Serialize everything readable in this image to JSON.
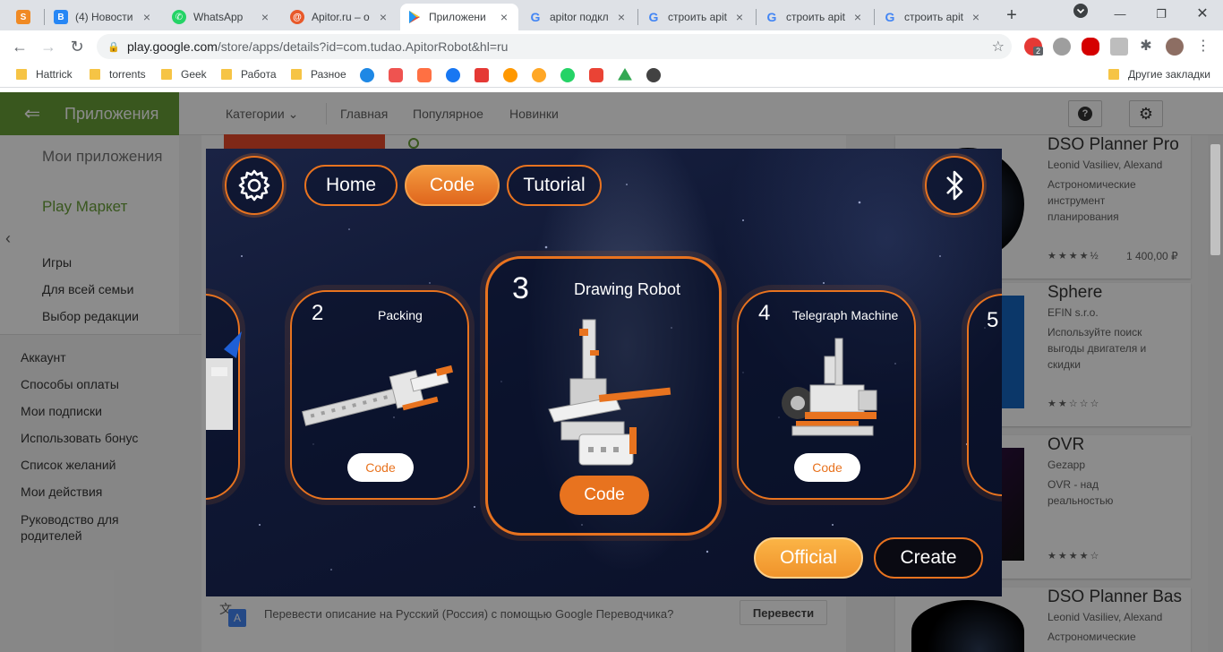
{
  "browser": {
    "tabs": [
      {
        "title": "",
        "icon": "s-badge-icon",
        "color": "#f08a24"
      },
      {
        "title": "(4) Новости",
        "icon": "vk-icon",
        "color": "#2787f5"
      },
      {
        "title": "WhatsApp",
        "icon": "whatsapp-icon",
        "color": "#25d366"
      },
      {
        "title": "Apitor.ru – о",
        "icon": "apitor-icon",
        "color": "#e8592a"
      },
      {
        "title": "Приложени",
        "icon": "google-play-icon",
        "color": "#00a173",
        "active": true
      },
      {
        "title": "apitor подкл",
        "icon": "google-icon",
        "color": "#4285f4"
      },
      {
        "title": "строить apit",
        "icon": "google-icon",
        "color": "#4285f4"
      },
      {
        "title": "строить apit",
        "icon": "google-icon",
        "color": "#4285f4"
      },
      {
        "title": "строить apit",
        "icon": "google-icon",
        "color": "#4285f4"
      }
    ],
    "new_tab": "+",
    "url_host": "play.google.com",
    "url_path": "/store/apps/details?id=com.tudao.ApitorRobot&hl=ru",
    "ext_badge": "2",
    "bookmarks": [
      "Hattrick",
      "torrents",
      "Geek",
      "Работа",
      "Разное"
    ],
    "other_bookmarks": "Другие закладки"
  },
  "play": {
    "section": "Приложения",
    "categories": "Категории",
    "nav": [
      "Главная",
      "Популярное",
      "Новинки"
    ],
    "side_top": [
      "Мои приложения",
      "Play Маркет"
    ],
    "side_sub": [
      "Игры",
      "Для всей семьи",
      "Выбор редакции"
    ],
    "side_bottom": [
      "Аккаунт",
      "Способы оплаты",
      "Мои подписки",
      "Использовать бонус",
      "Список желаний",
      "Мои действия",
      "Руководство для родителей"
    ],
    "translate_text": "Перевести описание на Русский (Россия) с помощью Google Переводчика?",
    "translate_btn": "Перевести",
    "cards": [
      {
        "title": "DSO Planner Pro",
        "dev": "Leonid Vasiliev, Alexand",
        "desc": "Астрономические инструмент планирования",
        "stars": "★★★★½",
        "price": "1 400,00 ₽"
      },
      {
        "title": "Sphere",
        "dev": "EFIN s.r.o.",
        "desc": "Используйте поиск выгоды двигателя и скидки",
        "stars": "★★☆☆☆",
        "price": ""
      },
      {
        "title": "OVR",
        "dev": "Gezapp",
        "desc": "OVR - над реальностью",
        "stars": "★★★★☆",
        "price": ""
      },
      {
        "title": "DSO Planner Bas",
        "dev": "Leonid Vasiliev, Alexand",
        "desc": "Астрономические",
        "stars": "",
        "price": ""
      }
    ]
  },
  "app": {
    "tabs": [
      "Home",
      "Code",
      "Tutorial"
    ],
    "active_tab": "Code",
    "projects": [
      {
        "num": "2",
        "name": "Packing",
        "button": "Code"
      },
      {
        "num": "3",
        "name": "Drawing Robot",
        "button": "Code"
      },
      {
        "num": "4",
        "name": "Telegraph Machine",
        "button": "Code"
      },
      {
        "num": "5",
        "name": "",
        "button": ""
      }
    ],
    "official": "Official",
    "create": "Create",
    "accent": "#e8731f"
  }
}
